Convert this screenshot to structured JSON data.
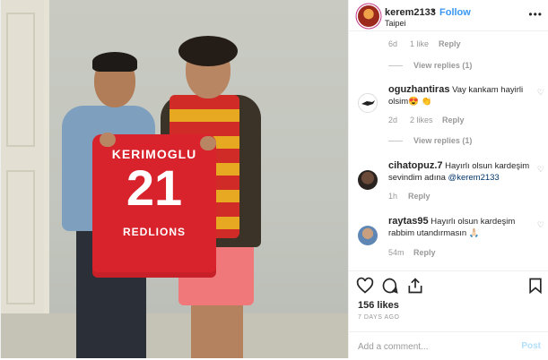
{
  "header": {
    "username": "kerem2133",
    "separator": "•",
    "follow_label": "Follow",
    "location": "Taipei",
    "more_icon": "more-icon"
  },
  "photo": {
    "jersey_name": "KERIMOGLU",
    "jersey_number": "21",
    "jersey_sponsor": "REDLIONS"
  },
  "comments": [
    {
      "time": "6d",
      "likes": "1 like",
      "reply_label": "Reply",
      "view_replies": "View replies (1)"
    },
    {
      "username": "oguzhantiras",
      "text": "Vay kankam hayirli olsim😍 👏",
      "time": "2d",
      "likes": "2 likes",
      "reply_label": "Reply",
      "view_replies": "View replies (1)"
    },
    {
      "username": "cihatopuz.7",
      "text": "Hayırlı olsun kardeşim sevindim adına",
      "mention": "@kerem2133",
      "time": "1h",
      "reply_label": "Reply"
    },
    {
      "username": "raytas95",
      "text": "Hayırlı olsun kardeşim rabbim utandırmasın 🙏🏻",
      "time": "54m",
      "reply_label": "Reply"
    }
  ],
  "actions": {
    "likes": "156 likes",
    "time_ago": "7 DAYS AGO"
  },
  "add_comment": {
    "placeholder": "Add a comment...",
    "post_label": "Post"
  },
  "colors": {
    "accent": "#3897f0",
    "post_disabled": "#b2dffc",
    "meta_gray": "#999999"
  }
}
